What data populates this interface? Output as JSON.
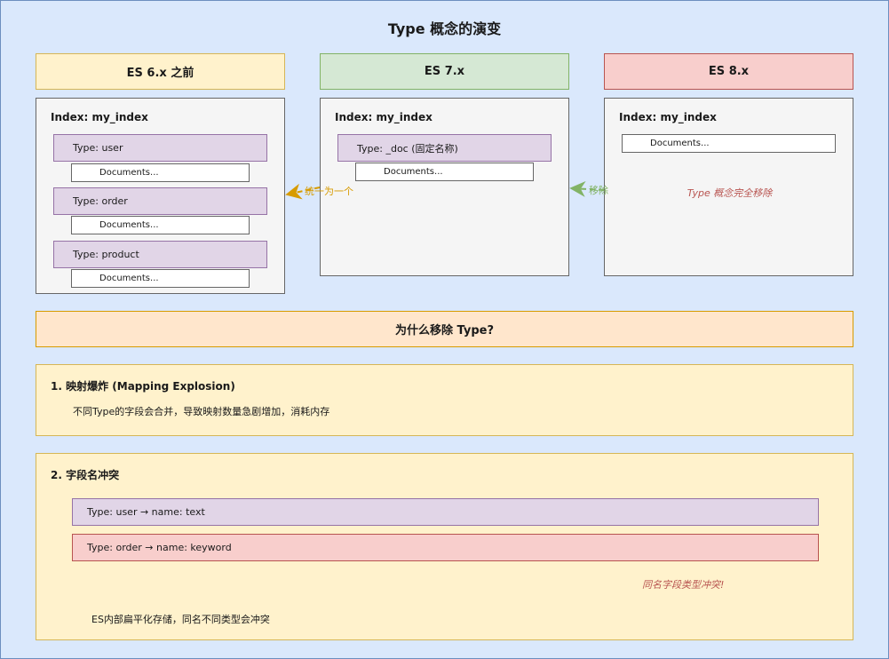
{
  "title": "Type 概念的演变",
  "versions": [
    {
      "header": "ES 6.x 之前",
      "index_label": "Index: my_index",
      "types": [
        {
          "label": "Type: user",
          "docs": "Documents..."
        },
        {
          "label": "Type: order",
          "docs": "Documents..."
        },
        {
          "label": "Type: product",
          "docs": "Documents..."
        }
      ]
    },
    {
      "header": "ES 7.x",
      "index_label": "Index: my_index",
      "types": [
        {
          "label": "Type: _doc (固定名称)",
          "docs": "Documents..."
        }
      ]
    },
    {
      "header": "ES 8.x",
      "index_label": "Index: my_index",
      "docs": "Documents...",
      "note": "Type 概念完全移除"
    }
  ],
  "arrows": [
    {
      "label": "统一为一个"
    },
    {
      "label": "移除"
    }
  ],
  "why": {
    "header": "为什么移除 Type?",
    "reasons": [
      {
        "title": "1. 映射爆炸 (Mapping Explosion)",
        "desc": "不同Type的字段会合并，导致映射数量急剧增加，消耗内存"
      },
      {
        "title": "2. 字段名冲突",
        "conflicts": [
          "Type: user → name: text",
          "Type: order → name: keyword"
        ],
        "note": "同名字段类型冲突!",
        "desc": "ES内部扁平化存储，同名不同类型会冲突"
      }
    ]
  },
  "colors": {
    "background": "#dae8fc",
    "yellow": "#fff2cc",
    "green": "#d5e8d4",
    "red": "#f8cecc",
    "purple": "#e1d5e7",
    "orange": "#ffe6cc",
    "arrow_orange": "#d79b00",
    "arrow_green": "#82b366"
  }
}
